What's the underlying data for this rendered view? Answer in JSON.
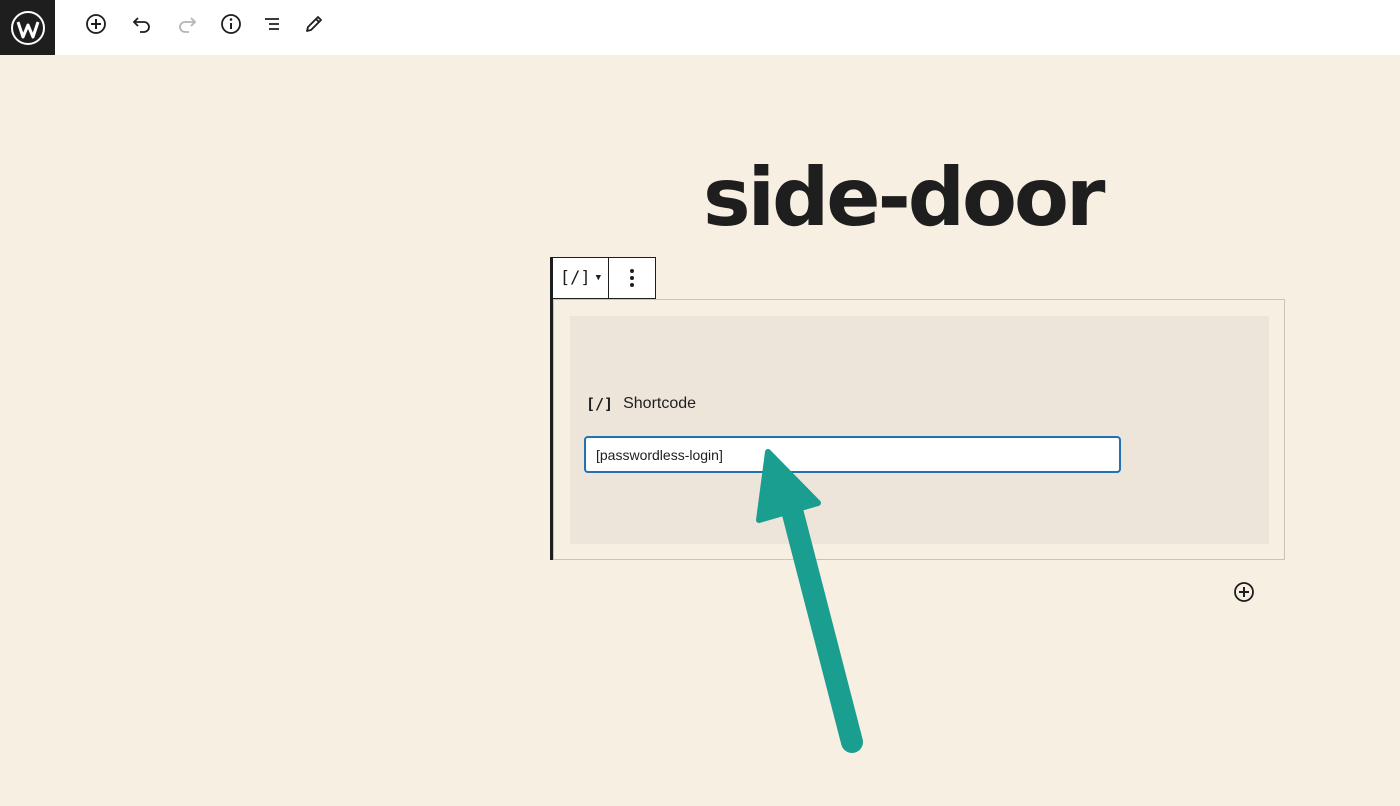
{
  "toolbar": {
    "logo": "wordpress-logo",
    "items": [
      "add-block-icon",
      "undo-icon",
      "redo-icon",
      "info-icon",
      "list-view-icon",
      "edit-icon"
    ]
  },
  "post": {
    "title": "side-door"
  },
  "block": {
    "type_symbol": "[/]",
    "label_icon": "[/]",
    "label": "Shortcode",
    "input_value": "[passwordless-login]"
  },
  "colors": {
    "background": "#f7efe2",
    "placeholder_bg": "#ede5d9",
    "input_focus": "#2271b1",
    "arrow": "#1a9e8f"
  }
}
